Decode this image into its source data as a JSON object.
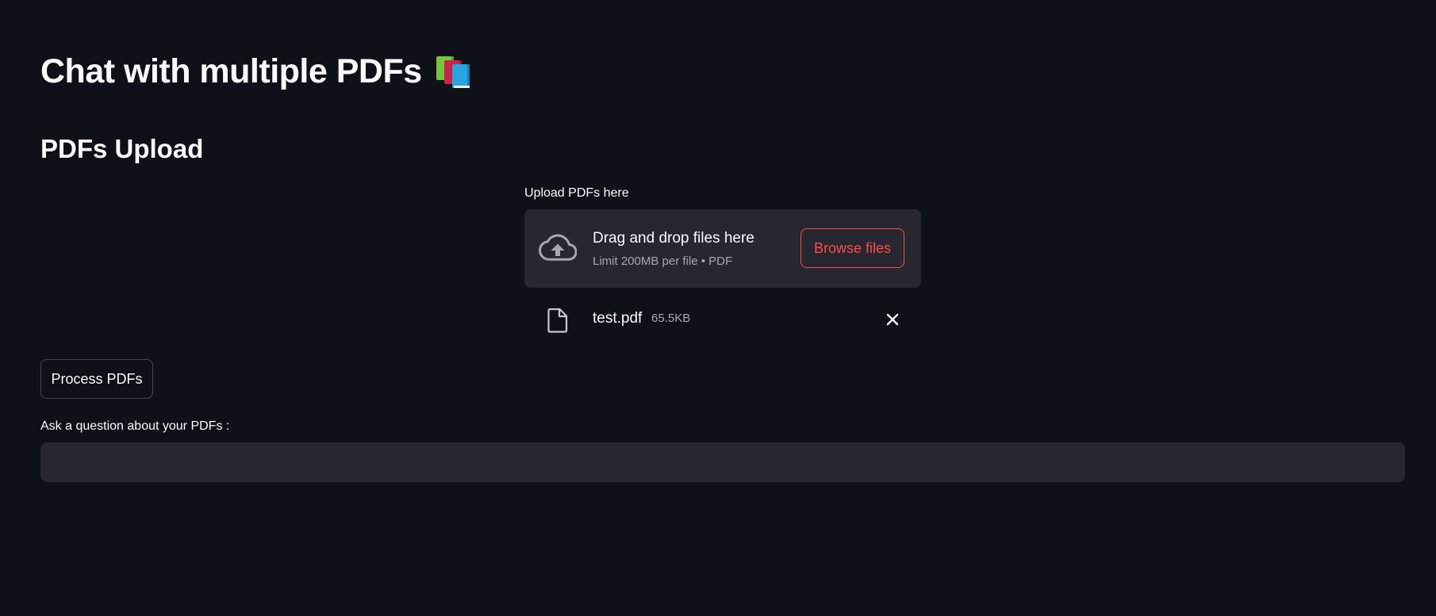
{
  "header": {
    "title": "Chat with multiple PDFs",
    "title_emoji_icon": "books-icon"
  },
  "upload_section": {
    "heading": "PDFs Upload",
    "uploader_label": "Upload PDFs here",
    "dropzone": {
      "icon": "cloud-upload-icon",
      "title": "Drag and drop files here",
      "limit_text": "Limit 200MB per file • PDF",
      "browse_label": "Browse files"
    },
    "files": [
      {
        "icon": "file-icon",
        "name": "test.pdf",
        "size": "65.5KB",
        "remove_icon": "close-icon"
      }
    ]
  },
  "actions": {
    "process_label": "Process PDFs"
  },
  "question": {
    "label": "Ask a question about your PDFs :",
    "value": "",
    "placeholder": ""
  },
  "colors": {
    "background": "#0e1117",
    "surface": "#262730",
    "text": "#fafafa",
    "muted_text": "#a3a8b8",
    "accent": "#ff4b4b"
  }
}
